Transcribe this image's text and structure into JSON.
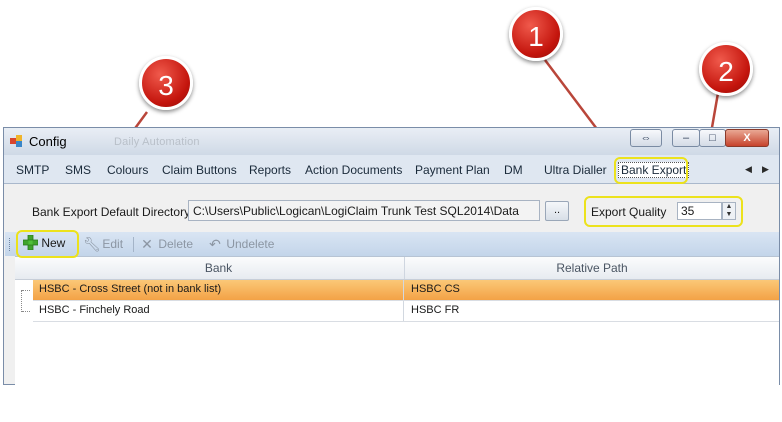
{
  "window": {
    "title": "Config",
    "ghost_title": "Daily Automation",
    "controls": {
      "resize": "⇔",
      "minimize": "–",
      "maximize": "□",
      "close": "X"
    }
  },
  "tabs": [
    "SMTP",
    "SMS",
    "Colours",
    "Claim Buttons",
    "Reports",
    "Action Documents",
    "Payment Plan",
    "DM",
    "Ultra Dialler",
    "Bank Export"
  ],
  "tab_nav": {
    "left": "◀",
    "right": "▶"
  },
  "settings": {
    "directory_label": "Bank Export Default Directory",
    "directory_value": "C:\\Users\\Public\\Logican\\LogiClaim Trunk Test SQL2014\\Data",
    "browse_label": "..",
    "quality_label": "Export Quality",
    "quality_value": "35"
  },
  "toolbar": {
    "new": "New",
    "edit": "Edit",
    "delete": "Delete",
    "undelete": "Undelete"
  },
  "grid": {
    "columns": [
      "Bank",
      "Relative Path"
    ],
    "rows": [
      {
        "bank": "HSBC - Cross Street (not in bank list)",
        "path": "HSBC CS"
      },
      {
        "bank": "HSBC  - Finchely Road",
        "path": "HSBC FR"
      }
    ]
  },
  "callouts": [
    "1",
    "2",
    "3"
  ],
  "colors": {
    "highlight": "#ece21c",
    "marker": "#d0211a",
    "selected_row": "#f5ab50",
    "arrow": "#b9463a"
  },
  "icons": {
    "new": "plus-icon",
    "edit": "wrench-icon",
    "delete": "x-icon",
    "undelete": "undo-arrow-icon"
  }
}
